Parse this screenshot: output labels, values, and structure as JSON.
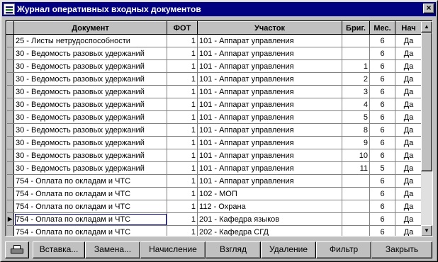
{
  "window": {
    "title": "Журнал оперативных входных документов",
    "close_glyph": "×"
  },
  "grid": {
    "columns": [
      "Документ",
      "ФОТ",
      "Участок",
      "Бриг.",
      "Мес.",
      "Нач"
    ],
    "current_row_marker": "▶",
    "rows": [
      {
        "doc": "25 - Листы нетрудоспособности",
        "fot": "1",
        "site": "101 - Аппарат управления",
        "brig": "",
        "mes": "6",
        "nach": "Да"
      },
      {
        "doc": "30 - Ведомость разовых удержаний",
        "fot": "1",
        "site": "101 - Аппарат управления",
        "brig": "",
        "mes": "6",
        "nach": "Да"
      },
      {
        "doc": "30 - Ведомость разовых удержаний",
        "fot": "1",
        "site": "101 - Аппарат управления",
        "brig": "1",
        "mes": "6",
        "nach": "Да"
      },
      {
        "doc": "30 - Ведомость разовых удержаний",
        "fot": "1",
        "site": "101 - Аппарат управления",
        "brig": "2",
        "mes": "6",
        "nach": "Да"
      },
      {
        "doc": "30 - Ведомость разовых удержаний",
        "fot": "1",
        "site": "101 - Аппарат управления",
        "brig": "3",
        "mes": "6",
        "nach": "Да"
      },
      {
        "doc": "30 - Ведомость разовых удержаний",
        "fot": "1",
        "site": "101 - Аппарат управления",
        "brig": "4",
        "mes": "6",
        "nach": "Да"
      },
      {
        "doc": "30 - Ведомость разовых удержаний",
        "fot": "1",
        "site": "101 - Аппарат управления",
        "brig": "5",
        "mes": "6",
        "nach": "Да"
      },
      {
        "doc": "30 - Ведомость разовых удержаний",
        "fot": "1",
        "site": "101 - Аппарат управления",
        "brig": "8",
        "mes": "6",
        "nach": "Да"
      },
      {
        "doc": "30 - Ведомость разовых удержаний",
        "fot": "1",
        "site": "101 - Аппарат управления",
        "brig": "9",
        "mes": "6",
        "nach": "Да"
      },
      {
        "doc": "30 - Ведомость разовых удержаний",
        "fot": "1",
        "site": "101 - Аппарат управления",
        "brig": "10",
        "mes": "6",
        "nach": "Да"
      },
      {
        "doc": "30 - Ведомость разовых удержаний",
        "fot": "1",
        "site": "101 - Аппарат управления",
        "brig": "11",
        "mes": "5",
        "nach": "Да"
      },
      {
        "doc": "754 - Оплата по окладам и ЧТС",
        "fot": "1",
        "site": "101 - Аппарат управления",
        "brig": "",
        "mes": "6",
        "nach": "Да"
      },
      {
        "doc": "754 - Оплата по окладам и ЧТС",
        "fot": "1",
        "site": "102 - МОП",
        "brig": "",
        "mes": "6",
        "nach": "Да"
      },
      {
        "doc": "754 - Оплата по окладам и ЧТС",
        "fot": "1",
        "site": "112 - Охрана",
        "brig": "",
        "mes": "6",
        "nach": "Да"
      },
      {
        "doc": "754 - Оплата по окладам и ЧТС",
        "fot": "1",
        "site": "201 - Кафедра языков",
        "brig": "",
        "mes": "6",
        "nach": "Да",
        "current": true
      },
      {
        "doc": "754 - Оплата по окладам и ЧТС",
        "fot": "1",
        "site": "202 - Кафедра   СГД",
        "brig": "",
        "mes": "6",
        "nach": "Да"
      }
    ]
  },
  "scrollbar": {
    "up_glyph": "▲",
    "down_glyph": "▼"
  },
  "toolbar": {
    "print_icon": "printer-icon",
    "insert_label": "Вставка...",
    "replace_label": "Замена...",
    "accrual_label": "Начисление",
    "view_label": "Взгляд",
    "delete_label": "Удаление",
    "filter_label": "Фильтр",
    "close_label": "Закрыть"
  }
}
